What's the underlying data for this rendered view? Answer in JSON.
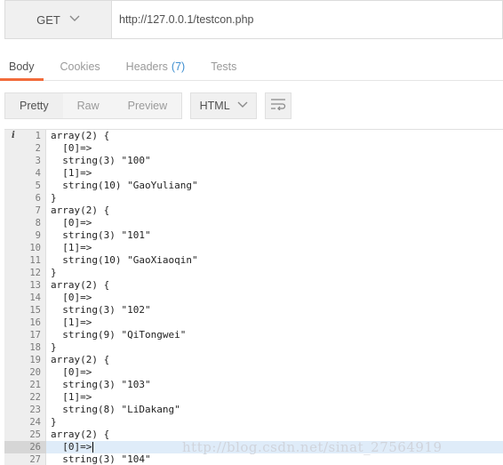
{
  "request": {
    "method": "GET",
    "url": "http://127.0.0.1/testcon.php"
  },
  "tabs": [
    {
      "label": "Body",
      "active": true
    },
    {
      "label": "Cookies"
    },
    {
      "label": "Headers",
      "count": "(7)"
    },
    {
      "label": "Tests"
    }
  ],
  "view_modes": [
    "Pretty",
    "Raw",
    "Preview"
  ],
  "format": "HTML",
  "code": [
    "array(2) {",
    "  [0]=>",
    "  string(3) \"100\"",
    "  [1]=>",
    "  string(10) \"GaoYuliang\"",
    "}",
    "array(2) {",
    "  [0]=>",
    "  string(3) \"101\"",
    "  [1]=>",
    "  string(10) \"GaoXiaoqin\"",
    "}",
    "array(2) {",
    "  [0]=>",
    "  string(3) \"102\"",
    "  [1]=>",
    "  string(9) \"QiTongwei\"",
    "}",
    "array(2) {",
    "  [0]=>",
    "  string(3) \"103\"",
    "  [1]=>",
    "  string(8) \"LiDakang\"",
    "}",
    "array(2) {",
    "  [0]=>",
    "  string(3) \"104\""
  ],
  "line_numbers": [
    "1",
    "2",
    "3",
    "4",
    "5",
    "6",
    "7",
    "8",
    "9",
    "10",
    "11",
    "12",
    "13",
    "14",
    "15",
    "16",
    "17",
    "18",
    "19",
    "20",
    "21",
    "22",
    "23",
    "24",
    "25",
    "26",
    "27"
  ],
  "active_line": 26,
  "info_marker": "i",
  "watermark": "http://blog.csdn.net/sinat_27564919",
  "colors": {
    "accent_tab": "#f26b3a",
    "headers_count": "#3f8fd0",
    "active_line_bg": "#dfecf9"
  }
}
